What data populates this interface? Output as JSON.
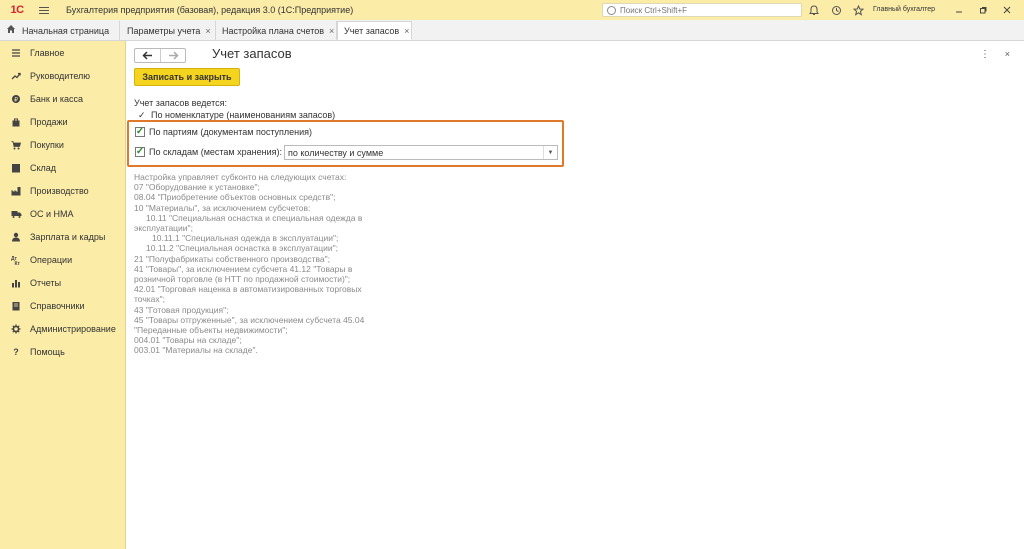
{
  "titlebar": {
    "logo": "1С",
    "title": "Бухгалтерия предприятия (базовая), редакция 3.0  (1С:Предприятие)",
    "search_placeholder": "Поиск Ctrl+Shift+F",
    "user": "Главный бухгалтер",
    "icons": [
      "bell-icon",
      "history-icon",
      "star-icon",
      "minimize-icon",
      "restore-icon",
      "close-icon"
    ]
  },
  "tabs": [
    {
      "label": "Начальная страница",
      "icon": "home-icon"
    },
    {
      "label": "Параметры учета",
      "close": "×"
    },
    {
      "label": "Настройка плана счетов",
      "close": "×"
    },
    {
      "label": "Учет запасов",
      "close": "×"
    }
  ],
  "sidebar": {
    "items": [
      {
        "label": "Главное",
        "icon": "menu-icon"
      },
      {
        "label": "Руководителю",
        "icon": "trend-icon"
      },
      {
        "label": "Банк и касса",
        "icon": "coin-icon"
      },
      {
        "label": "Продажи",
        "icon": "bag-icon"
      },
      {
        "label": "Покупки",
        "icon": "cart-icon"
      },
      {
        "label": "Склад",
        "icon": "box-icon"
      },
      {
        "label": "Производство",
        "icon": "factory-icon"
      },
      {
        "label": "ОС и НМА",
        "icon": "truck-icon"
      },
      {
        "label": "Зарплата и кадры",
        "icon": "user-icon"
      },
      {
        "label": "Операции",
        "icon": "operations-icon"
      },
      {
        "label": "Отчеты",
        "icon": "chart-icon"
      },
      {
        "label": "Справочники",
        "icon": "book-icon"
      },
      {
        "label": "Администрирование",
        "icon": "gear-icon"
      },
      {
        "label": "Помощь",
        "icon": "help-icon"
      }
    ]
  },
  "form": {
    "back": "🡐",
    "forward": "🡒",
    "title": "Учет запасов",
    "more": "⋮",
    "close": "×",
    "save_button": "Записать и закрыть",
    "accounting_label": "Учет запасов ведется:",
    "nomenclature_mark": "✓",
    "nomenclature_label": "По номенклатуре (наименованиям запасов)",
    "batches_label": "По партиям (документам поступления)",
    "batches_checked": true,
    "warehouses_label": "По складам (местам хранения):",
    "warehouses_checked": true,
    "warehouses_select": "по количеству и сумме",
    "check_glyph": "✓"
  },
  "info_lines": [
    "Настройка управляет субконто на следующих счетах:",
    "07 \"Оборудование к установке\";",
    "08.04 \"Приобретение объектов основных средств\";",
    "10 \"Материалы\", за исключением субсчетов:",
    "    10.11 \"Специальная оснастка и специальная одежда в",
    "эксплуатации\";",
    "        10.11.1 \"Специальная одежда в эксплуатации\";",
    "    10.11.2 \"Специальная оснастка в эксплуатации\";",
    "21 \"Полуфабрикаты собственного производства\";",
    "41 \"Товары\", за исключением субсчета 41.12 \"Товары в",
    "розничной торговле (в НТТ по продажной стоимости)\";",
    "42.01 \"Торговая наценка в автоматизированных торговых",
    "точках\";",
    "43 \"Готовая продукция\";",
    "45 \"Товары отгруженные\", за исключением субсчета 45.04",
    "\"Переданные объекты недвижимости\";",
    "004.01 \"Товары на складе\";",
    "003.01 \"Материалы на складе\"."
  ]
}
